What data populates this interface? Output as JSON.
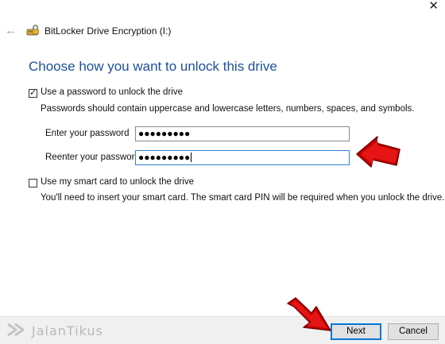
{
  "window": {
    "close_glyph": "✕",
    "back_glyph": "←",
    "title": "BitLocker Drive Encryption (I:)",
    "icon": "bitlocker-drive-icon"
  },
  "page": {
    "heading": "Choose how you want to unlock this drive"
  },
  "password_option": {
    "checked": true,
    "label": "Use a password to unlock the drive",
    "description": "Passwords should contain uppercase and lowercase letters, numbers, spaces, and symbols.",
    "enter_label": "Enter your password",
    "enter_value": "●●●●●●●●●",
    "reenter_label": "Reenter your password",
    "reenter_value": "●●●●●●●●●"
  },
  "smartcard_option": {
    "checked": false,
    "label": "Use my smart card to unlock the drive",
    "description": "You'll need to insert your smart card. The smart card PIN will be required when you unlock the drive."
  },
  "footer": {
    "next_label": "Next",
    "cancel_label": "Cancel"
  },
  "watermark": {
    "text": "JalanTikus"
  },
  "colors": {
    "heading": "#1e4f99",
    "focus_border": "#0078d7",
    "annotation_arrow": "#d10000"
  }
}
